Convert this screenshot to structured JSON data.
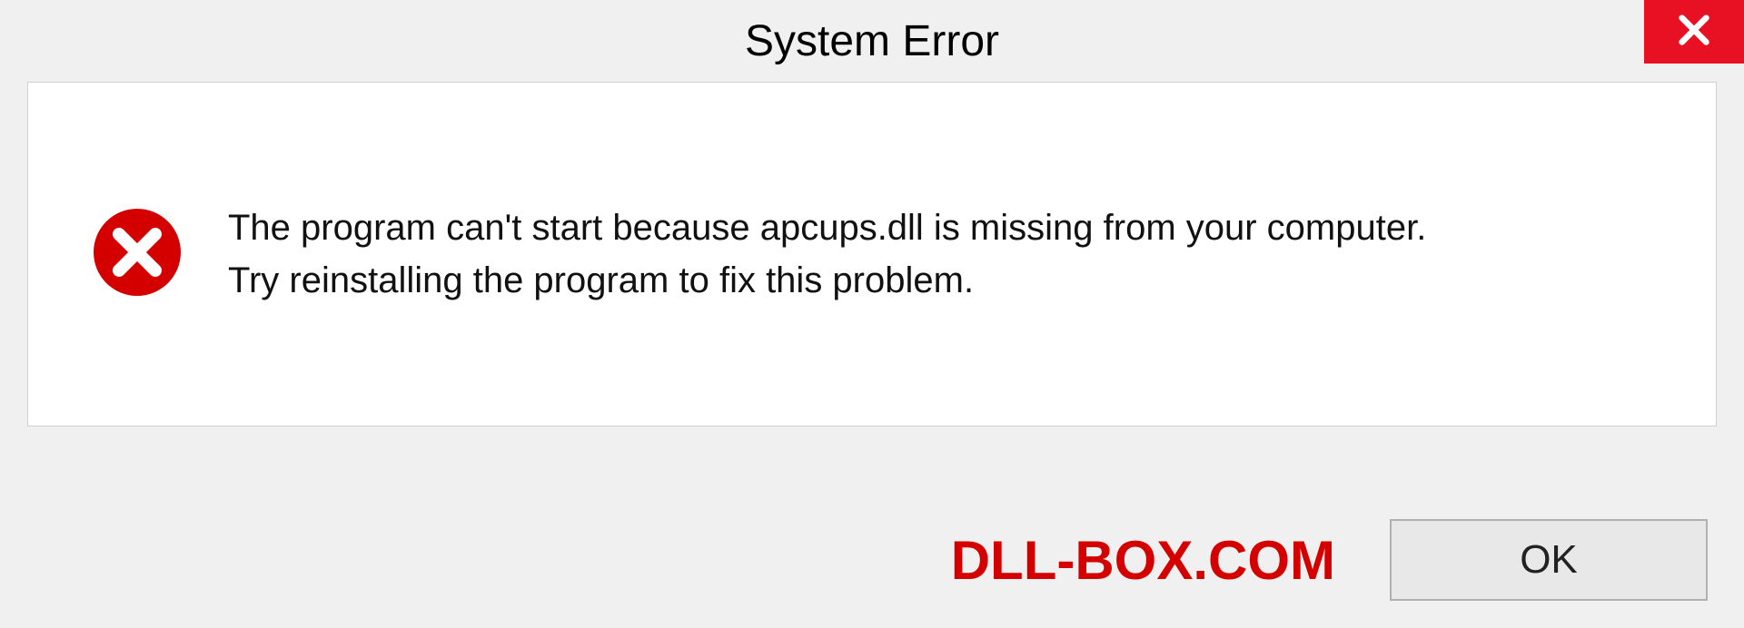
{
  "titlebar": {
    "title": "System Error"
  },
  "message": {
    "line1": "The program can't start because apcups.dll is missing from your computer.",
    "line2": "Try reinstalling the program to fix this problem."
  },
  "footer": {
    "brand": "DLL-BOX.COM",
    "ok_label": "OK"
  },
  "colors": {
    "close_bg": "#e81123",
    "error_icon": "#d40000",
    "brand_color": "#d40000"
  }
}
